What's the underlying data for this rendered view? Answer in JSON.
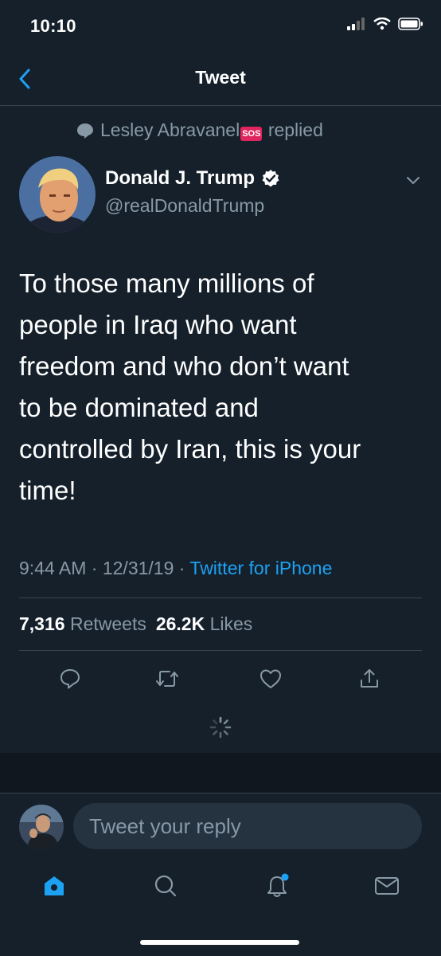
{
  "status_bar": {
    "time": "10:10"
  },
  "header": {
    "title": "Tweet"
  },
  "context": {
    "name": "Lesley Abravanel",
    "badge": "SOS",
    "action": "replied"
  },
  "author": {
    "name": "Donald J. Trump",
    "handle": "@realDonaldTrump"
  },
  "tweet": {
    "text_lines": [
      "To those many millions of",
      "people in Iraq who want",
      "freedom and who don’t want",
      "to be dominated and",
      "controlled by Iran, this is your",
      "time!"
    ]
  },
  "meta": {
    "time": "9:44 AM",
    "sep1": "·",
    "date": "12/31/19",
    "sep2": "·",
    "source": "Twitter for iPhone"
  },
  "stats": {
    "retweets_count": "7,316",
    "retweets_label": "Retweets",
    "likes_count": "26.2K",
    "likes_label": "Likes"
  },
  "reply": {
    "placeholder": "Tweet your reply"
  },
  "colors": {
    "background": "#15202b",
    "accent": "#1da1f2",
    "secondary_text": "#8899a6",
    "divider": "#38444d"
  },
  "icons": [
    "back-chevron",
    "comment-bubble",
    "verified-badge",
    "chevron-down",
    "reply",
    "retweet",
    "like",
    "share",
    "spinner",
    "home",
    "search",
    "notifications",
    "messages"
  ]
}
